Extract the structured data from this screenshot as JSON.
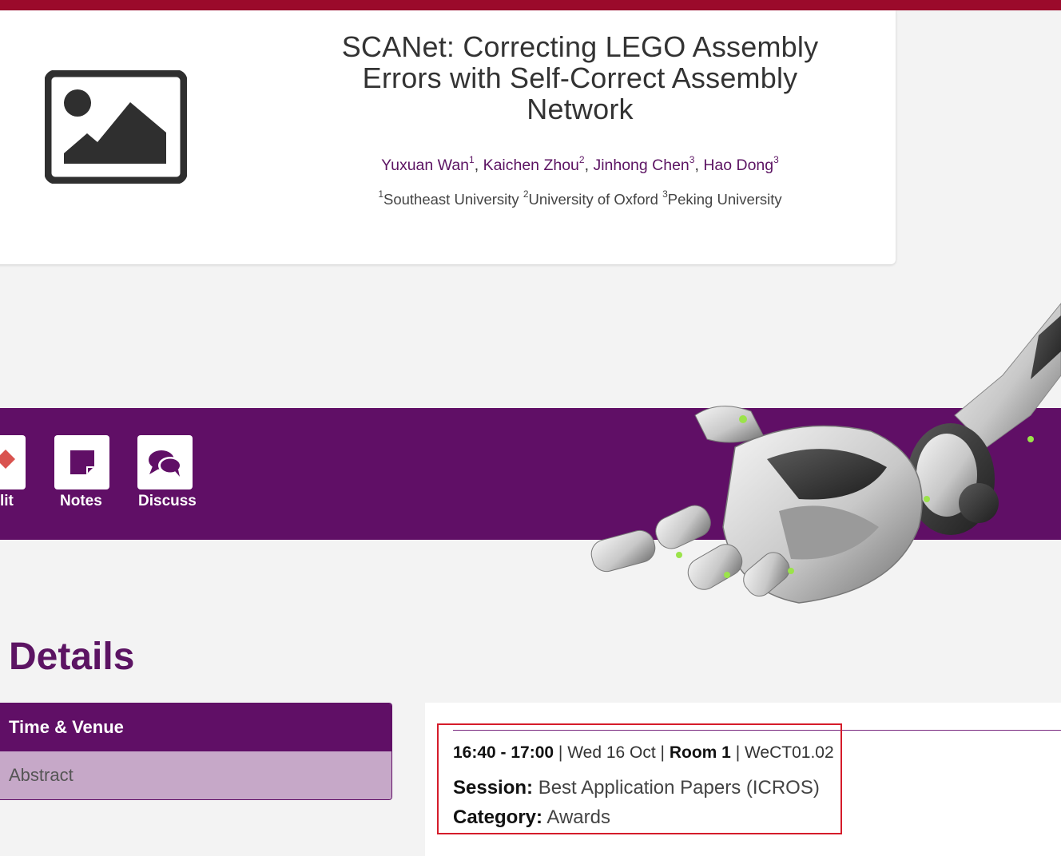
{
  "paper": {
    "title": "SCANet: Correcting LEGO Assembly Errors with Self-Correct Assembly Network",
    "authors": [
      {
        "name": "Yuxuan Wan",
        "aff": "1"
      },
      {
        "name": "Kaichen Zhou",
        "aff": "2"
      },
      {
        "name": "Jinhong Chen",
        "aff": "3"
      },
      {
        "name": "Hao Dong",
        "aff": "3"
      }
    ],
    "affiliations": [
      {
        "num": "1",
        "name": "Southeast University"
      },
      {
        "num": "2",
        "name": "University of Oxford"
      },
      {
        "num": "3",
        "name": "Peking University"
      }
    ],
    "thumbnail_icon": "image-placeholder-icon"
  },
  "toolbar": {
    "edit_label": "lit",
    "notes_label": "Notes",
    "discuss_label": "Discuss"
  },
  "details": {
    "heading": "Details",
    "tabs": [
      {
        "label": "Time & Venue",
        "active": true
      },
      {
        "label": "Abstract",
        "active": false
      }
    ],
    "time": "16:40 - 17:00",
    "date": "Wed 16 Oct",
    "room": "Room 1",
    "code": "WeCT01.02",
    "session_label": "Session:",
    "session_value": "Best Application Papers (ICROS)",
    "category_label": "Category:",
    "category_value": "Awards"
  },
  "colors": {
    "top_bar": "#9b0a2b",
    "purple": "#600f66",
    "tab_inactive": "#c6a8c8",
    "highlight": "#d51c2a"
  }
}
